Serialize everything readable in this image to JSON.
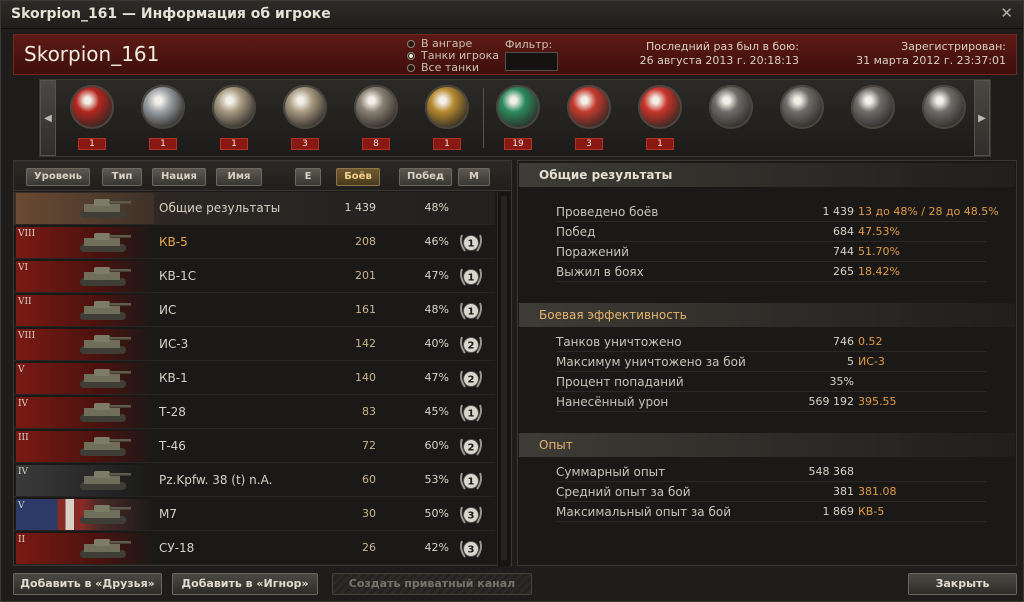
{
  "window": {
    "title": "Skorpion_161 — Информация об игроке"
  },
  "header": {
    "player_name": "Skorpion_161",
    "radio_options": [
      "В ангаре",
      "Танки игрока",
      "Все танки"
    ],
    "radio_selected": "Танки игрока",
    "filter_label": "Фильтр:",
    "filter_value": "",
    "last_battle_label": "Последний раз был в бою:",
    "last_battle_value": "26 августа 2013 г. 20:18:13",
    "registered_label": "Зарегистрирован:",
    "registered_value": "31 марта 2012 г. 23:37:01"
  },
  "medals": [
    {
      "icon": "red-star-banner-medal-icon",
      "count": "1",
      "color": "#b3261e"
    },
    {
      "icon": "crossed-guns-medal-icon",
      "count": "1",
      "color": "#9aa0a3"
    },
    {
      "icon": "tank-wreath-medal-icon",
      "count": "1",
      "color": "#a89a82"
    },
    {
      "icon": "target-wreath-medal-icon",
      "count": "3",
      "color": "#a89a82"
    },
    {
      "icon": "tank-shield-medal-icon",
      "count": "8",
      "color": "#8a8174"
    },
    {
      "icon": "tank-duel-medal-icon",
      "count": "1",
      "color": "#b5892f"
    },
    {
      "icon": "green-banner-medal-icon",
      "count": "19",
      "color": "#2b8a5d"
    },
    {
      "icon": "red-sword-medal-icon",
      "count": "3",
      "color": "#c23a2e"
    },
    {
      "icon": "red-emblem-medal-icon",
      "count": "1",
      "color": "#c7342a"
    },
    {
      "icon": "grey-achievement-1-icon",
      "count": "",
      "color": "#6e6d69"
    },
    {
      "icon": "grey-achievement-2-icon",
      "count": "",
      "color": "#6e6d69"
    },
    {
      "icon": "grey-achievement-3-icon",
      "count": "",
      "color": "#6e6d69"
    },
    {
      "icon": "grey-achievement-4-icon",
      "count": "",
      "color": "#6e6d69"
    }
  ],
  "sort_buttons": {
    "level": "Уровень",
    "type": "Тип",
    "nation": "Нация",
    "name": "Имя",
    "e": "E",
    "battles": "Боёв",
    "wins": "Побед",
    "m": "M",
    "active": "Боёв"
  },
  "vehicles": [
    {
      "tier": "",
      "name": "Общие результаты",
      "battles": "1 439",
      "wins": "48%",
      "mastery": "",
      "nation": "all",
      "highlight": false
    },
    {
      "tier": "VIII",
      "name": "КВ-5",
      "battles": "208",
      "wins": "46%",
      "mastery": "1",
      "nation": "ussr",
      "highlight": true
    },
    {
      "tier": "VI",
      "name": "КВ-1С",
      "battles": "201",
      "wins": "47%",
      "mastery": "1",
      "nation": "ussr",
      "highlight": false
    },
    {
      "tier": "VII",
      "name": "ИС",
      "battles": "161",
      "wins": "48%",
      "mastery": "1",
      "nation": "ussr",
      "highlight": false
    },
    {
      "tier": "VIII",
      "name": "ИС-3",
      "battles": "142",
      "wins": "40%",
      "mastery": "2",
      "nation": "ussr",
      "highlight": false
    },
    {
      "tier": "V",
      "name": "КВ-1",
      "battles": "140",
      "wins": "47%",
      "mastery": "2",
      "nation": "ussr",
      "highlight": false
    },
    {
      "tier": "IV",
      "name": "Т-28",
      "battles": "83",
      "wins": "45%",
      "mastery": "1",
      "nation": "ussr",
      "highlight": false
    },
    {
      "tier": "III",
      "name": "Т-46",
      "battles": "72",
      "wins": "60%",
      "mastery": "2",
      "nation": "ussr",
      "highlight": false
    },
    {
      "tier": "IV",
      "name": "Pz.Kpfw. 38 (t) n.A.",
      "battles": "60",
      "wins": "53%",
      "mastery": "1",
      "nation": "germany",
      "highlight": false
    },
    {
      "tier": "V",
      "name": "M7",
      "battles": "30",
      "wins": "50%",
      "mastery": "3",
      "nation": "usa",
      "highlight": false
    },
    {
      "tier": "II",
      "name": "СУ-18",
      "battles": "26",
      "wins": "42%",
      "mastery": "3",
      "nation": "ussr",
      "highlight": false
    }
  ],
  "stats": {
    "overall": {
      "title": "Общие результаты",
      "rows": [
        {
          "label": "Проведено боёв",
          "value": "1 439",
          "extra": "13 до 48% / 28 до 48.5%"
        },
        {
          "label": "Побед",
          "value": "684",
          "extra": "47.53%"
        },
        {
          "label": "Поражений",
          "value": "744",
          "extra": "51.70%"
        },
        {
          "label": "Выжил в боях",
          "value": "265",
          "extra": "18.42%"
        }
      ]
    },
    "combat": {
      "title": "Боевая эффективность",
      "rows": [
        {
          "label": "Танков уничтожено",
          "value": "746",
          "extra": "0.52"
        },
        {
          "label": "Максимум уничтожено за бой",
          "value": "5",
          "extra": "ИС-3"
        },
        {
          "label": "Процент попаданий",
          "value": "35%",
          "extra": ""
        },
        {
          "label": "Нанесённый урон",
          "value": "569 192",
          "extra": "395.55"
        }
      ]
    },
    "experience": {
      "title": "Опыт",
      "rows": [
        {
          "label": "Суммарный опыт",
          "value": "548 368",
          "extra": ""
        },
        {
          "label": "Средний опыт за бой",
          "value": "381",
          "extra": "381.08"
        },
        {
          "label": "Максимальный опыт за бой",
          "value": "1 869",
          "extra": "КВ-5"
        }
      ]
    }
  },
  "footer": {
    "add_friend": "Добавить в «Друзья»",
    "add_ignore": "Добавить в «Игнор»",
    "create_channel": "Создать приватный канал",
    "close": "Закрыть"
  }
}
